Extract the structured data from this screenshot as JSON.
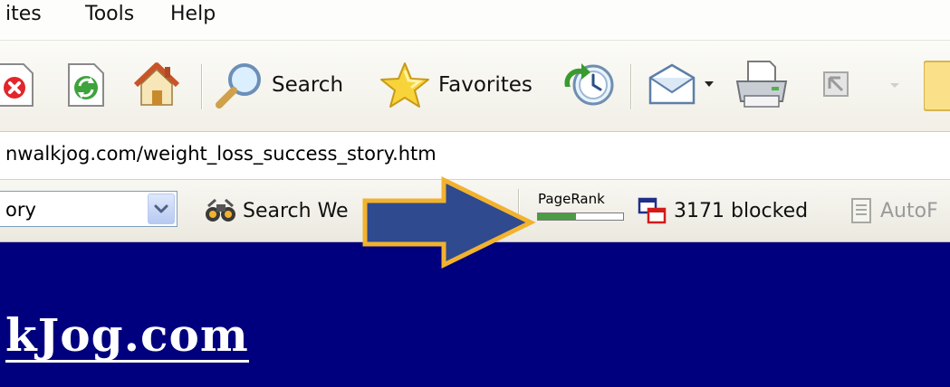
{
  "menubar": {
    "items": [
      "ites",
      "Tools",
      "Help"
    ]
  },
  "toolbar": {
    "search_label": "Search",
    "favorites_label": "Favorites",
    "icons": [
      "stop-icon",
      "refresh-icon",
      "home-icon",
      "search-icon",
      "favorites-star-icon",
      "history-icon",
      "mail-icon",
      "print-icon",
      "edit-icon",
      "folder-icon"
    ]
  },
  "address": {
    "url": "nwalkjog.com/weight_loss_success_story.htm"
  },
  "googlebar": {
    "search_value": "ory",
    "search_web_label": "Search We",
    "pagerank_label": "PageRank",
    "pagerank_fraction": 0.45,
    "popup_blocked_label": "3171 blocked",
    "autofill_label": "AutoF"
  },
  "page": {
    "site_title": "kJog.com"
  },
  "colors": {
    "page_background": "#00007e",
    "arrow_fill": "#2f4a8e",
    "arrow_outline": "#f2b22e",
    "pagerank_green": "#4c9b45"
  }
}
